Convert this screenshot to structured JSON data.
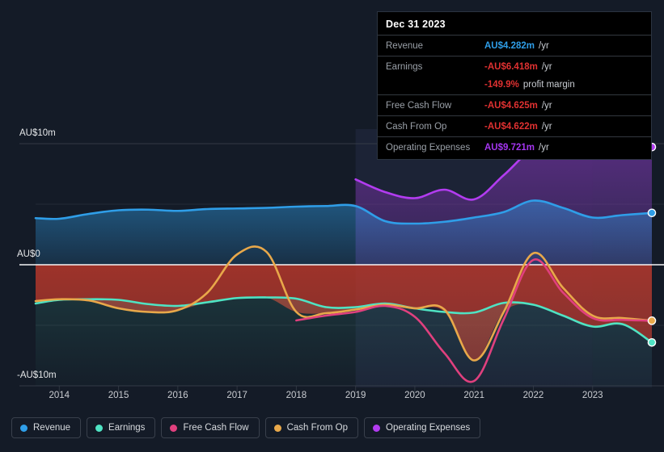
{
  "tooltip": {
    "title": "Dec 31 2023",
    "rows": [
      {
        "label": "Revenue",
        "value": "AU$4.282m",
        "unit": "/yr",
        "color": "blue"
      },
      {
        "label": "Earnings",
        "value": "-AU$6.418m",
        "unit": "/yr",
        "color": "red"
      },
      {
        "label": "",
        "value": "-149.9%",
        "unit": "profit margin",
        "color": "red",
        "sub": true
      },
      {
        "label": "Free Cash Flow",
        "value": "-AU$4.625m",
        "unit": "/yr",
        "color": "red"
      },
      {
        "label": "Cash From Op",
        "value": "-AU$4.622m",
        "unit": "/yr",
        "color": "red"
      },
      {
        "label": "Operating Expenses",
        "value": "AU$9.721m",
        "unit": "/yr",
        "color": "purple"
      }
    ]
  },
  "legend": [
    {
      "label": "Revenue",
      "color": "#2f9ee8"
    },
    {
      "label": "Earnings",
      "color": "#4fe3c3"
    },
    {
      "label": "Free Cash Flow",
      "color": "#e0407e"
    },
    {
      "label": "Cash From Op",
      "color": "#e8a84a"
    },
    {
      "label": "Operating Expenses",
      "color": "#b23cf0"
    }
  ],
  "chart_data": {
    "type": "area",
    "title": "",
    "xlabel": "",
    "ylabel": "AU$",
    "ylim": [
      -10,
      10
    ],
    "ytick_labels": [
      "AU$10m",
      "AU$0",
      "-AU$10m"
    ],
    "ytick_values": [
      10,
      0,
      -10
    ],
    "grid": true,
    "legend_position": "bottom",
    "x_tick_labels": [
      "2014",
      "2015",
      "2016",
      "2017",
      "2018",
      "2019",
      "2020",
      "2021",
      "2022",
      "2023"
    ],
    "x_tick_values": [
      2014,
      2015,
      2016,
      2017,
      2018,
      2019,
      2020,
      2021,
      2022,
      2023
    ],
    "x_domain": [
      2013.6,
      2024.0
    ],
    "series": [
      {
        "name": "Revenue",
        "color": "#2f9ee8",
        "x": [
          2013.6,
          2014.0,
          2014.5,
          2015.0,
          2015.5,
          2016.0,
          2016.5,
          2017.0,
          2017.5,
          2018.0,
          2018.5,
          2019.0,
          2019.5,
          2020.0,
          2020.5,
          2021.0,
          2021.5,
          2022.0,
          2022.5,
          2023.0,
          2023.5,
          2024.0
        ],
        "values": [
          3.85,
          3.8,
          4.2,
          4.5,
          4.55,
          4.45,
          4.6,
          4.65,
          4.7,
          4.8,
          4.85,
          4.85,
          3.6,
          3.4,
          3.55,
          3.9,
          4.35,
          5.3,
          4.7,
          3.9,
          4.1,
          4.282
        ]
      },
      {
        "name": "Earnings",
        "color": "#4fe3c3",
        "x": [
          2013.6,
          2014.0,
          2014.5,
          2015.0,
          2015.5,
          2016.0,
          2016.5,
          2017.0,
          2017.5,
          2018.0,
          2018.5,
          2019.0,
          2019.5,
          2020.0,
          2020.5,
          2021.0,
          2021.5,
          2022.0,
          2022.5,
          2023.0,
          2023.5,
          2024.0
        ],
        "values": [
          -3.2,
          -2.9,
          -2.85,
          -2.9,
          -3.25,
          -3.4,
          -3.1,
          -2.75,
          -2.7,
          -2.8,
          -3.5,
          -3.5,
          -3.2,
          -3.6,
          -3.9,
          -3.95,
          -3.15,
          -3.3,
          -4.2,
          -5.1,
          -4.9,
          -6.418
        ]
      },
      {
        "name": "Free Cash Flow",
        "color": "#e0407e",
        "x": [
          2018.0,
          2018.5,
          2019.0,
          2019.5,
          2020.0,
          2020.5,
          2021.0,
          2021.5,
          2022.0,
          2022.5,
          2023.0,
          2023.5,
          2024.0
        ],
        "values": [
          -4.6,
          -4.2,
          -3.9,
          -3.4,
          -4.3,
          -7.3,
          -9.6,
          -4.5,
          0.4,
          -2.3,
          -4.4,
          -4.55,
          -4.625
        ]
      },
      {
        "name": "Cash From Op",
        "color": "#e8a84a",
        "x": [
          2013.6,
          2014.0,
          2014.5,
          2015.0,
          2015.5,
          2016.0,
          2016.5,
          2017.0,
          2017.5,
          2018.0,
          2018.5,
          2019.0,
          2019.5,
          2020.0,
          2020.5,
          2021.0,
          2021.5,
          2022.0,
          2022.5,
          2023.0,
          2023.5,
          2024.0
        ],
        "values": [
          -3.0,
          -2.85,
          -2.95,
          -3.6,
          -3.9,
          -3.75,
          -2.3,
          0.85,
          1.05,
          -3.9,
          -4.0,
          -3.7,
          -3.3,
          -3.6,
          -3.7,
          -7.9,
          -3.9,
          0.95,
          -1.9,
          -4.2,
          -4.4,
          -4.622
        ]
      },
      {
        "name": "Operating Expenses",
        "color": "#b23cf0",
        "x": [
          2019.0,
          2019.5,
          2020.0,
          2020.5,
          2021.0,
          2021.5,
          2022.0,
          2022.5,
          2023.0,
          2023.5,
          2024.0
        ],
        "values": [
          7.05,
          6.0,
          5.5,
          6.2,
          5.4,
          7.4,
          9.6,
          10.2,
          8.8,
          9.3,
          9.721
        ]
      }
    ],
    "shaded_bands": [
      {
        "from": 2019.0,
        "to": 2023.0,
        "tone": "mid"
      },
      {
        "from": 2023.0,
        "to": 2024.0,
        "tone": "light"
      }
    ],
    "endpoint_markers": [
      {
        "series": "Operating Expenses",
        "value": 9.721,
        "color": "#b23cf0"
      },
      {
        "series": "Revenue",
        "value": 4.282,
        "color": "#2f9ee8"
      },
      {
        "series": "Cash From Op",
        "value": -4.622,
        "color": "#e8a84a"
      },
      {
        "series": "Earnings",
        "value": -6.418,
        "color": "#4fe3c3"
      }
    ]
  },
  "colors": {
    "background": "#141b27",
    "grid": "#39404b",
    "zero_line": "#ffffff",
    "positive_fill": "#1d4a6b",
    "negative_fill": "#a33a3a"
  }
}
